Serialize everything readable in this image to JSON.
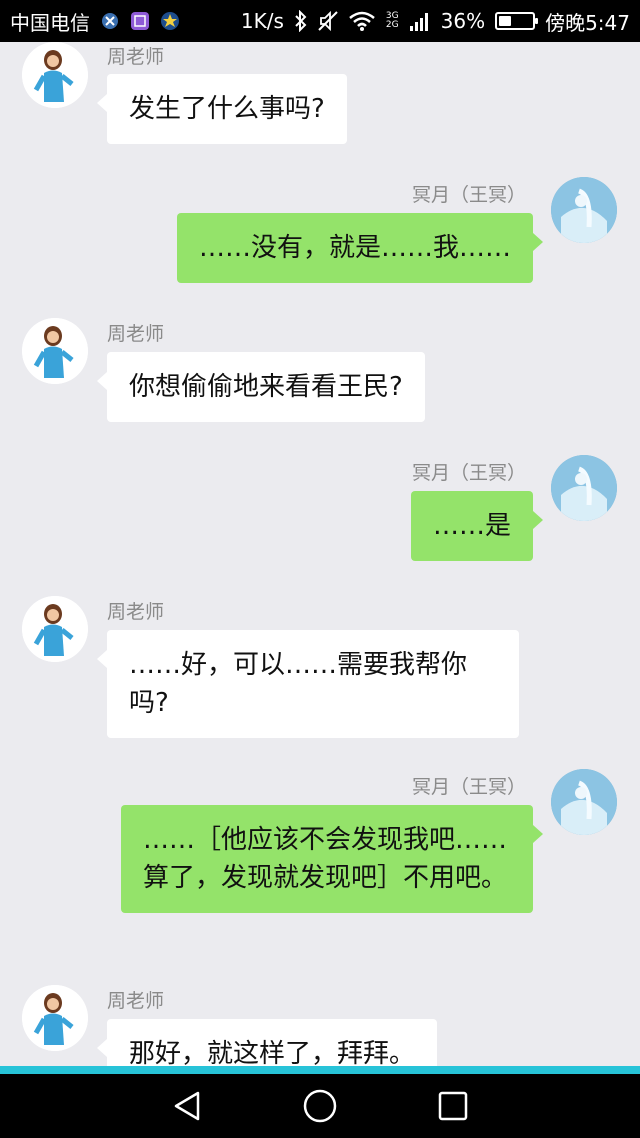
{
  "status_bar": {
    "carrier": "中国电信",
    "speed": "1K/s",
    "net_tech_top": "3G",
    "net_tech_bottom": "2G",
    "battery_percent": "36%",
    "battery_level": 0.36,
    "time": "傍晚5:47"
  },
  "chat": {
    "messages": [
      {
        "side": "left",
        "sender": "周老师",
        "text": "发生了什么事吗?"
      },
      {
        "side": "right",
        "sender": "冥月（王冥）",
        "text": "……没有，就是……我……"
      },
      {
        "side": "left",
        "sender": "周老师",
        "text": "你想偷偷地来看看王民?"
      },
      {
        "side": "right",
        "sender": "冥月（王冥）",
        "text": "……是"
      },
      {
        "side": "left",
        "sender": "周老师",
        "text": "……好，可以……需要我帮你吗?"
      },
      {
        "side": "right",
        "sender": "冥月（王冥）",
        "text": "……［他应该不会发现我吧……算了，发现就发现吧］不用吧。"
      },
      {
        "side": "left",
        "sender": "周老师",
        "text": "那好，就这样了，拜拜。"
      }
    ]
  },
  "colors": {
    "background": "#ebebef",
    "self_bubble": "#94e36a",
    "other_bubble": "#ffffff",
    "accent_line": "#27c3d8"
  },
  "icons": {
    "back": "back-triangle-icon",
    "home": "home-circle-icon",
    "recents": "recents-square-icon"
  }
}
